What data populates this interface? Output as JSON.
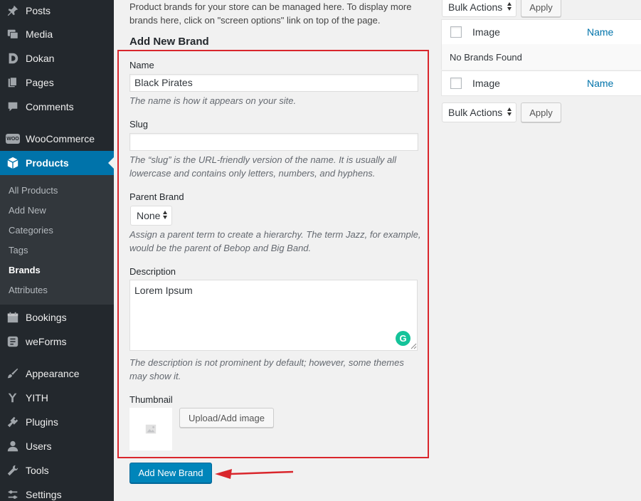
{
  "sidebar": {
    "items": [
      {
        "label": "Posts",
        "icon": "pin-icon"
      },
      {
        "label": "Media",
        "icon": "media-icon"
      },
      {
        "label": "Dokan",
        "icon": "dokan-icon"
      },
      {
        "label": "Pages",
        "icon": "pages-icon"
      },
      {
        "label": "Comments",
        "icon": "comments-icon"
      },
      {
        "label": "WooCommerce",
        "icon": "woo-icon"
      },
      {
        "label": "Products",
        "icon": "products-icon"
      },
      {
        "label": "Bookings",
        "icon": "bookings-icon"
      },
      {
        "label": "weForms",
        "icon": "weforms-icon"
      },
      {
        "label": "Appearance",
        "icon": "appearance-icon"
      },
      {
        "label": "YITH",
        "icon": "yith-icon"
      },
      {
        "label": "Plugins",
        "icon": "plugins-icon"
      },
      {
        "label": "Users",
        "icon": "users-icon"
      },
      {
        "label": "Tools",
        "icon": "tools-icon"
      },
      {
        "label": "Settings",
        "icon": "settings-icon"
      }
    ],
    "submenu": [
      "All Products",
      "Add New",
      "Categories",
      "Tags",
      "Brands",
      "Attributes"
    ],
    "woo_badge": "WOO"
  },
  "intro": "Product brands for your store can be managed here. To display more brands here, click on \"screen options\" link on top of the page.",
  "form": {
    "heading": "Add New Brand",
    "name_label": "Name",
    "name_value": "Black Pirates",
    "name_help": "The name is how it appears on your site.",
    "slug_label": "Slug",
    "slug_value": "",
    "slug_help": "The “slug” is the URL-friendly version of the name. It is usually all lowercase and contains only letters, numbers, and hyphens.",
    "parent_label": "Parent Brand",
    "parent_value": "None",
    "parent_help": "Assign a parent term to create a hierarchy. The term Jazz, for example, would be the parent of Bebop and Big Band.",
    "description_label": "Description",
    "description_value": "Lorem Ipsum",
    "description_help": "The description is not prominent by default; however, some themes may show it.",
    "thumbnail_label": "Thumbnail",
    "upload_button": "Upload/Add image",
    "submit_button": "Add New Brand",
    "grammarly_letter": "G"
  },
  "table": {
    "bulk_actions": "Bulk Actions",
    "apply": "Apply",
    "col_image": "Image",
    "col_name": "Name",
    "empty_message": "No Brands Found"
  },
  "colors": {
    "sidebar_bg": "#23282d",
    "active_bg": "#0073aa",
    "highlight": "#d9262c",
    "primary_button": "#0085ba",
    "link": "#0073aa"
  }
}
